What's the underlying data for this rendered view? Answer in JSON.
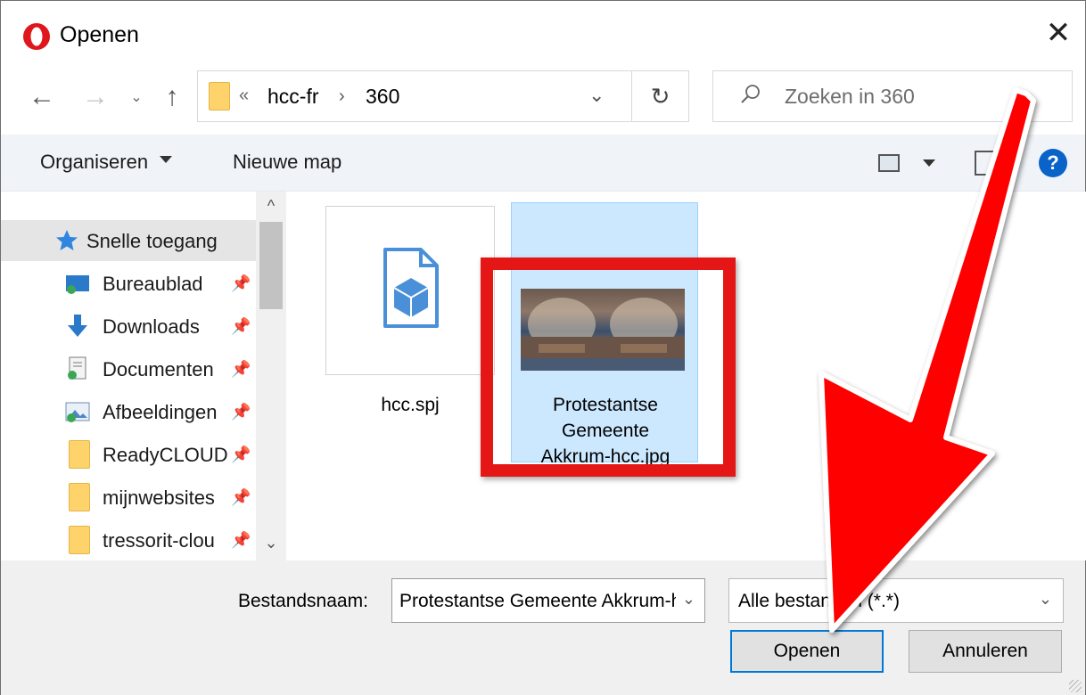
{
  "window": {
    "title": "Openen",
    "close_glyph": "✕"
  },
  "nav": {
    "back_glyph": "←",
    "forward_glyph": "→",
    "recent_glyph": "⌄",
    "up_glyph": "↑"
  },
  "address": {
    "overflow_glyph": "«",
    "crumbs": [
      "hcc-fr",
      "360"
    ],
    "separator": "›",
    "dropdown_glyph": "⌄",
    "refresh_glyph": "↻"
  },
  "search": {
    "placeholder": "Zoeken in 360"
  },
  "toolbar": {
    "organize_label": "Organiseren",
    "new_folder_label": "Nieuwe map",
    "help_label": "?"
  },
  "sidebar": {
    "items": [
      {
        "label": "Snelle toegang",
        "icon": "star-icon",
        "pinned": false,
        "selected": true
      },
      {
        "label": "Bureaublad",
        "icon": "desktop-icon",
        "pinned": true
      },
      {
        "label": "Downloads",
        "icon": "download-icon",
        "pinned": true
      },
      {
        "label": "Documenten",
        "icon": "documents-icon",
        "pinned": true
      },
      {
        "label": "Afbeeldingen",
        "icon": "pictures-icon",
        "pinned": true
      },
      {
        "label": "ReadyCLOUD",
        "icon": "folder-icon",
        "pinned": true
      },
      {
        "label": "mijnwebsites",
        "icon": "folder-icon",
        "pinned": true
      },
      {
        "label": "tressorit-clou",
        "icon": "folder-icon",
        "pinned": true
      }
    ],
    "pin_glyph": "📌"
  },
  "files": [
    {
      "name": "hcc.spj",
      "icon": "3d-file-icon",
      "selected": false
    },
    {
      "name_lines": [
        "Protestantse",
        "Gemeente",
        "Akkrum-hcc.jpg"
      ],
      "icon": "panorama-thumbnail",
      "selected": true
    }
  ],
  "bottom": {
    "filename_label": "Bestandsnaam:",
    "filename_value": "Protestantse Gemeente Akkrum-hcc.jpg",
    "filetype_value": "Alle bestanden (*.*)",
    "open_label": "Openen",
    "cancel_label": "Annuleren"
  },
  "colors": {
    "accent": "#0078d7",
    "selection": "#cce8ff",
    "highlight": "#e51616",
    "arrow": "#ff0000"
  }
}
